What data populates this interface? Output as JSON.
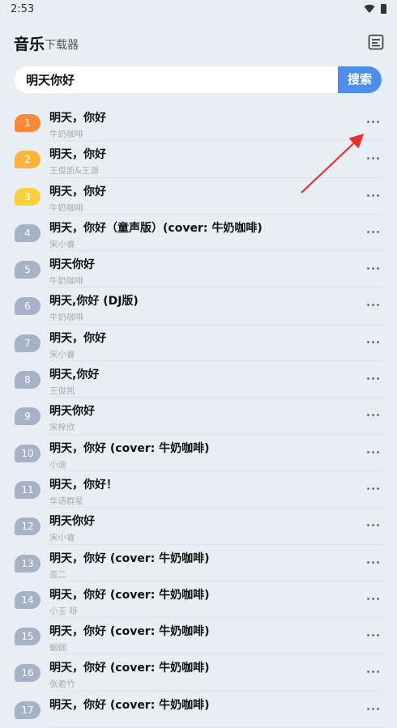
{
  "status_bar": {
    "time": "2:53"
  },
  "header": {
    "title": "音乐",
    "subtitle": "下载器"
  },
  "search": {
    "value": "明天你好",
    "button_label": "搜索"
  },
  "colors": {
    "accent": "#4d8fe8",
    "badge_1": "#f7893a",
    "badge_2": "#f9b43c",
    "badge_3": "#fad03a",
    "badge_other": "#a6b2c6",
    "arrow": "#e8302a"
  },
  "results": [
    {
      "rank": "1",
      "song": "明天，你好",
      "artist": "牛奶咖啡"
    },
    {
      "rank": "2",
      "song": "明天，你好",
      "artist": "王俊凯&王源"
    },
    {
      "rank": "3",
      "song": "明天，你好",
      "artist": "牛奶咖啡"
    },
    {
      "rank": "4",
      "song": "明天，你好（童声版）(cover: 牛奶咖啡)",
      "artist": "宋小睿"
    },
    {
      "rank": "5",
      "song": "明天你好",
      "artist": "牛奶咖啡"
    },
    {
      "rank": "6",
      "song": "明天,你好 (DJ版)",
      "artist": "牛奶咖啡"
    },
    {
      "rank": "7",
      "song": "明天，你好",
      "artist": "宋小睿"
    },
    {
      "rank": "8",
      "song": "明天,你好",
      "artist": "王俊凯"
    },
    {
      "rank": "9",
      "song": "明天你好",
      "artist": "宋梓欣"
    },
    {
      "rank": "10",
      "song": "明天，你好 (cover: 牛奶咖啡)",
      "artist": "小迪"
    },
    {
      "rank": "11",
      "song": "明天，你好！",
      "artist": "华语群星"
    },
    {
      "rank": "12",
      "song": "明天你好",
      "artist": "宋小睿"
    },
    {
      "rank": "13",
      "song": "明天，你好 (cover: 牛奶咖啡)",
      "artist": "歪二"
    },
    {
      "rank": "14",
      "song": "明天，你好 (cover: 牛奶咖啡)",
      "artist": "小玉 呀"
    },
    {
      "rank": "15",
      "song": "明天，你好 (cover: 牛奶咖啡)",
      "artist": "蝈蝈"
    },
    {
      "rank": "16",
      "song": "明天，你好 (cover: 牛奶咖啡)",
      "artist": "张君竹"
    },
    {
      "rank": "17",
      "song": "明天，你好 (cover: 牛奶咖啡)",
      "artist": ""
    }
  ]
}
